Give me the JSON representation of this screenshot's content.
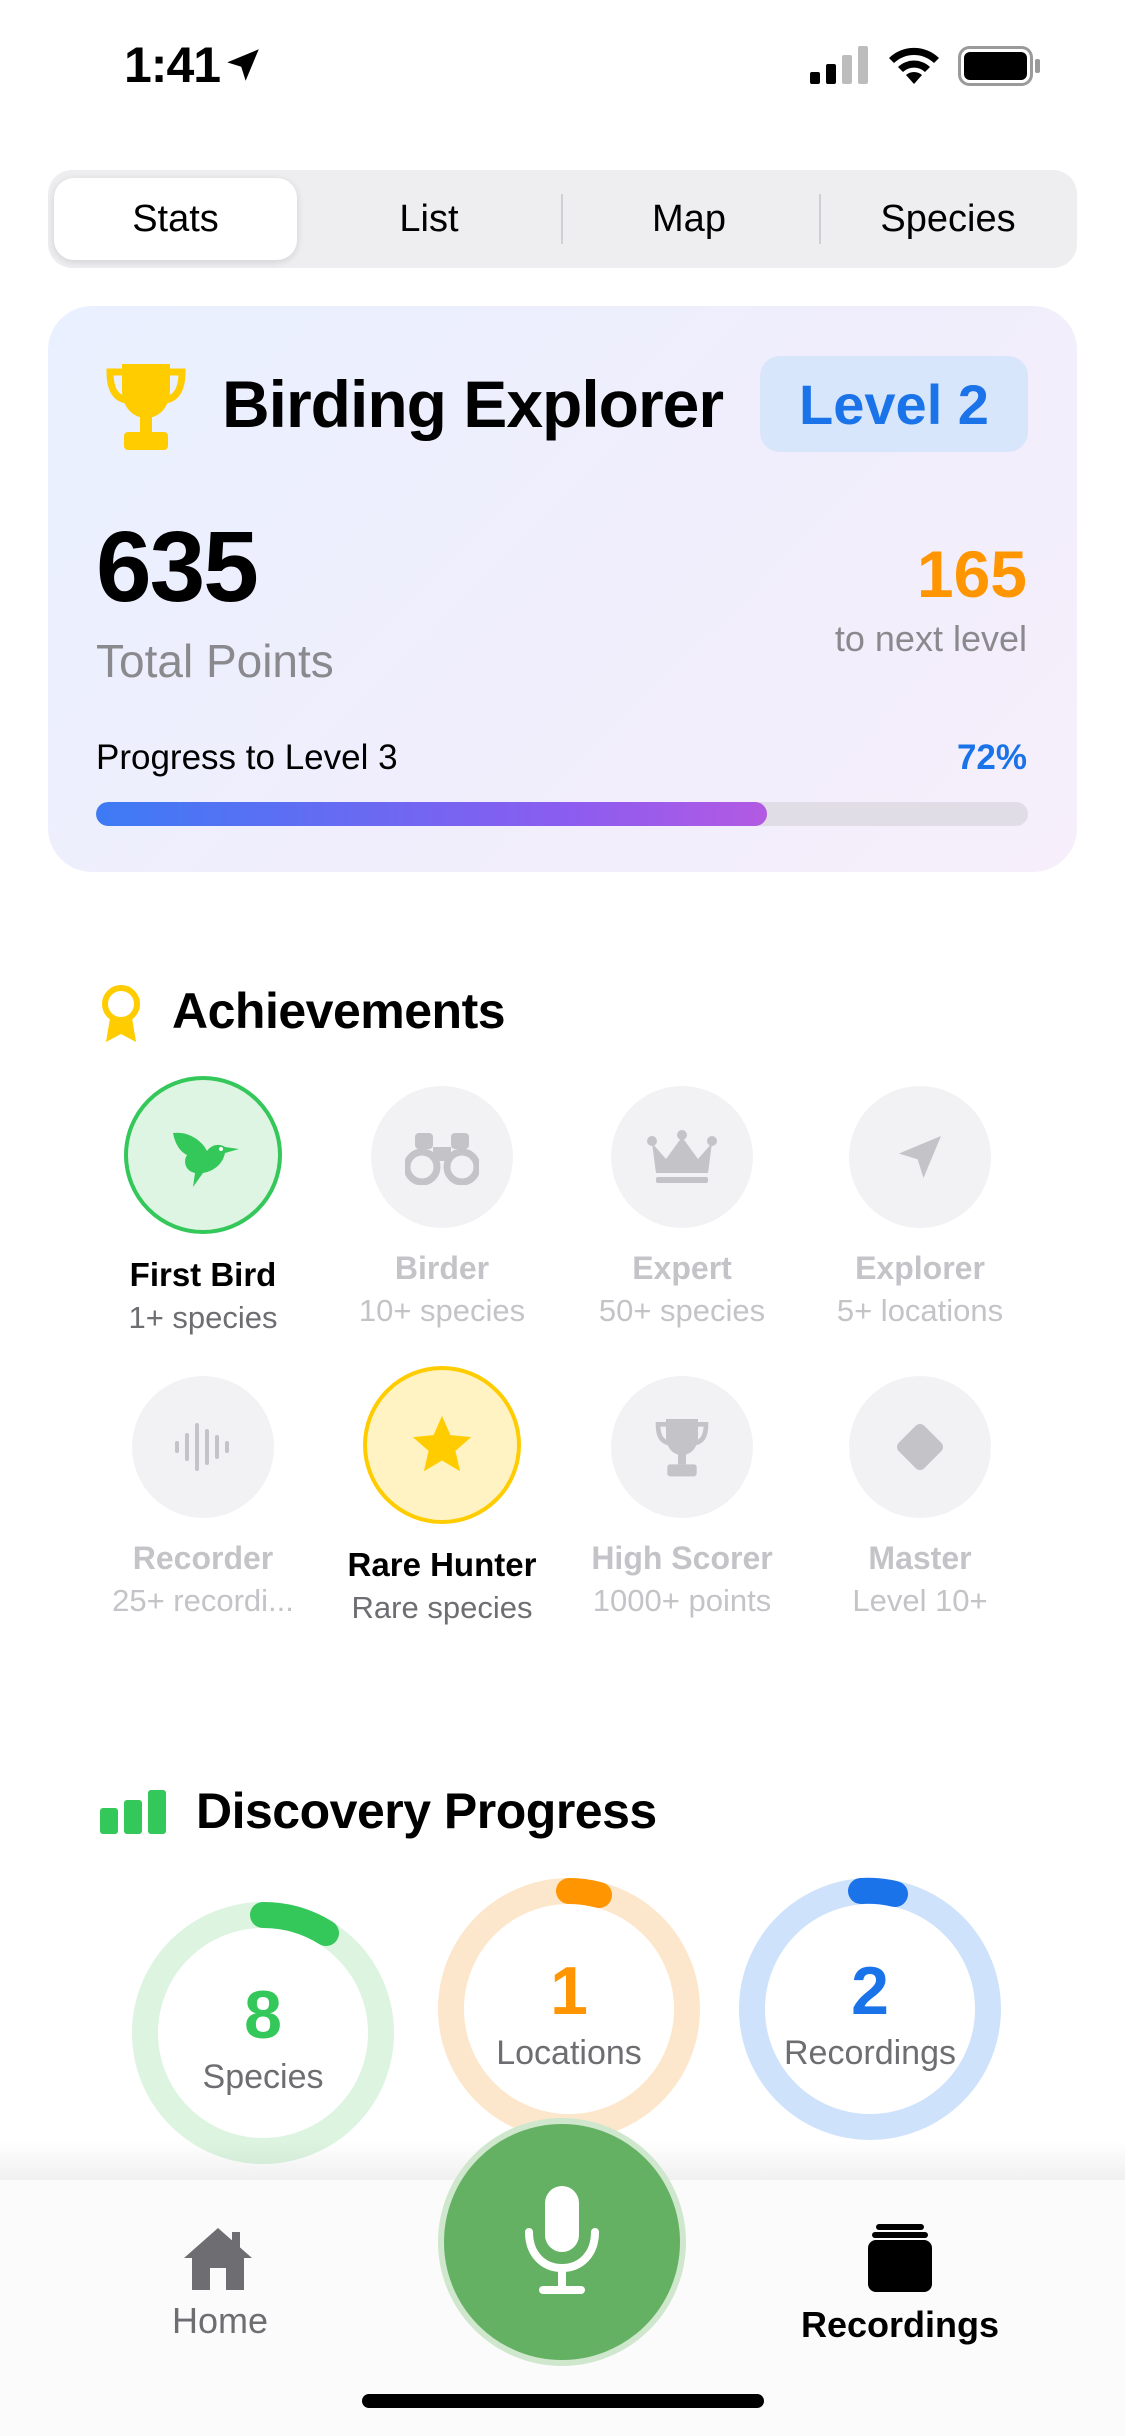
{
  "status_bar": {
    "time": "1:41"
  },
  "segments": [
    {
      "label": "Stats",
      "active": true
    },
    {
      "label": "List",
      "active": false
    },
    {
      "label": "Map",
      "active": false
    },
    {
      "label": "Species",
      "active": false
    }
  ],
  "explorer_card": {
    "title": "Birding Explorer",
    "level_badge": "Level 2",
    "total_points": "635",
    "total_points_label": "Total Points",
    "points_to_next": "165",
    "points_to_next_label": "to next level",
    "progress_label": "Progress to Level 3",
    "progress_percent_text": "72%",
    "progress_fraction": 0.72
  },
  "achievements": {
    "title": "Achievements",
    "items": [
      {
        "name": "First Bird",
        "sub": "1+ species",
        "icon": "hummingbird-icon",
        "earned": true
      },
      {
        "name": "Birder",
        "sub": "10+ species",
        "icon": "binoculars-icon",
        "earned": false
      },
      {
        "name": "Expert",
        "sub": "50+ species",
        "icon": "crown-icon",
        "earned": false
      },
      {
        "name": "Explorer",
        "sub": "5+ locations",
        "icon": "location-arrow-icon",
        "earned": false
      },
      {
        "name": "Recorder",
        "sub": "25+ recordi...",
        "icon": "waveform-icon",
        "earned": false
      },
      {
        "name": "Rare Hunter",
        "sub": "Rare species",
        "icon": "star-icon",
        "earned": true
      },
      {
        "name": "High Scorer",
        "sub": "1000+ points",
        "icon": "trophy-icon",
        "earned": false
      },
      {
        "name": "Master",
        "sub": "Level 10+",
        "icon": "diamond-icon",
        "earned": false
      }
    ]
  },
  "discovery": {
    "title": "Discovery Progress",
    "rings": [
      {
        "value": "8",
        "label": "Species",
        "color": "#34c759",
        "track": "#dcf4e0"
      },
      {
        "value": "1",
        "label": "Locations",
        "color": "#ff9500",
        "track": "#fde7cc"
      },
      {
        "value": "2",
        "label": "Recordings",
        "color": "#1a73e8",
        "track": "#cfe2fb"
      }
    ]
  },
  "tab_bar": {
    "home_label": "Home",
    "recordings_label": "Recordings",
    "mic_color": "#65b164"
  },
  "colors": {
    "accent_blue": "#1a73e8",
    "accent_orange": "#ff9500",
    "accent_green": "#34c759",
    "accent_gold": "#ffcc00"
  }
}
